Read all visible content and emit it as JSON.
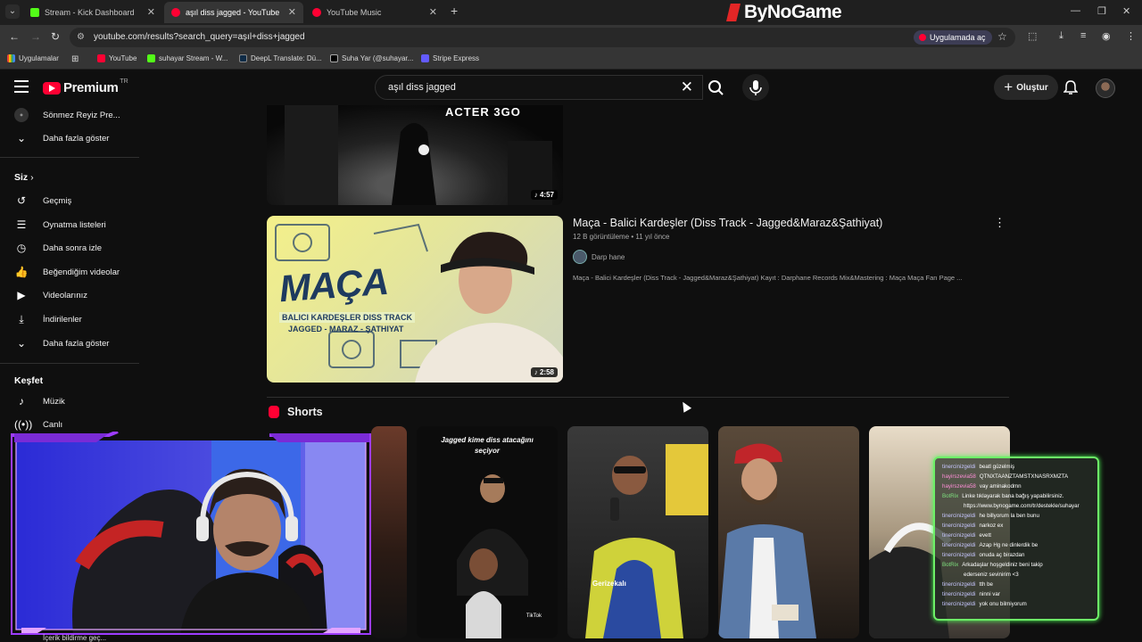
{
  "browser": {
    "tabs": [
      {
        "title": "Stream - Kick Dashboard",
        "color": "#53fc18"
      },
      {
        "title": "aşıl diss jagged - YouTube",
        "color": "#ff0033"
      },
      {
        "title": "YouTube Music",
        "color": "#ff0033"
      }
    ],
    "brand": "ByNoGame",
    "url": "youtube.com/results?search_query=aşıl+diss+jagged",
    "open_in_app": "Uygulamada aç",
    "bookmarks": [
      "Uygulamalar",
      "YouTube",
      "suhayar Stream - W...",
      "DeepL Translate: Dü...",
      "Suha Yar (@suhayar...",
      "Stripe Express"
    ]
  },
  "header": {
    "logo_text": "Premium",
    "logo_region": "TR",
    "search_value": "aşıl diss jagged",
    "create_label": "Oluştur"
  },
  "sidebar": {
    "top_items": [
      {
        "label": "Sönmez Reyiz Pre...",
        "icon": "channel-avatar"
      },
      {
        "label": "Daha fazla göster",
        "icon": "chevron-down-icon"
      }
    ],
    "you_header": "Siz",
    "you_items": [
      {
        "label": "Geçmiş",
        "icon": "history-icon"
      },
      {
        "label": "Oynatma listeleri",
        "icon": "playlist-icon"
      },
      {
        "label": "Daha sonra izle",
        "icon": "clock-icon"
      },
      {
        "label": "Beğendiğim videolar",
        "icon": "thumbs-up-icon"
      },
      {
        "label": "Videolarınız",
        "icon": "video-icon"
      },
      {
        "label": "İndirilenler",
        "icon": "download-icon"
      },
      {
        "label": "Daha fazla göster",
        "icon": "chevron-down-icon"
      }
    ],
    "explore_header": "Keşfet",
    "explore_items": [
      {
        "label": "Müzik",
        "icon": "music-note-icon"
      },
      {
        "label": "Canlı",
        "icon": "live-icon"
      }
    ],
    "bottom_partial": "İçerik bildirme geç..."
  },
  "results": {
    "first_video": {
      "thumb_text": "ACTER 3GO",
      "duration": "4:57"
    },
    "second_video": {
      "title": "Maça - Balici Kardeşler (Diss Track - Jagged&Maraz&Şathiyat)",
      "views": "12 B görüntüleme",
      "age": "11 yıl önce",
      "channel": "Darp hane",
      "description": "Maça - Balici Kardeşler (Diss Track - Jagged&Maraz&Şathiyat) Kayıt : Darphane Records Mix&Mastering : Maça Maça Fan Page ...",
      "thumb_title": "MAÇA",
      "thumb_sub1": "BALICI KARDEŞLER DISS TRACK",
      "thumb_sub2": "JAGGED - MARAZ - ŞATHIYAT",
      "duration": "2:58"
    }
  },
  "shorts": {
    "header": "Shorts",
    "items": [
      {
        "caption": ""
      },
      {
        "caption": "Jagged kime diss atacağını seçiyor",
        "badge": "TikTok"
      },
      {
        "caption": "Gerizekalı"
      },
      {
        "caption": ""
      },
      {
        "caption": ""
      }
    ]
  },
  "chat": [
    {
      "user": "tinercinizgeldi",
      "msg": "beatl güzelmiş",
      "kind": "u"
    },
    {
      "user": "hayirszevia58",
      "msg": "QTNXTAANZTAMSTXNASRXMZTA",
      "kind": "p"
    },
    {
      "user": "hayirszevia58",
      "msg": "vay aminakodmn",
      "kind": "p"
    },
    {
      "user": "BotRix",
      "msg": "Linke tıklayarak bana bağış yapabilirsiniz.",
      "kind": "b"
    },
    {
      "user": "",
      "msg": "https://www.bynogame.com/tr/destekle/suhayar",
      "kind": "u"
    },
    {
      "user": "tinercinizgeldi",
      "msg": "he billyorum la ben bunu",
      "kind": "u"
    },
    {
      "user": "tinercinizgeldi",
      "msg": "narkoz ex",
      "kind": "u"
    },
    {
      "user": "tinercinizgeldi",
      "msg": "evett",
      "kind": "u"
    },
    {
      "user": "tinercinizgeldi",
      "msg": "Azap Hg ne dinlerdik be",
      "kind": "u"
    },
    {
      "user": "tinercinizgeldi",
      "msg": "onuda aç birazdan",
      "kind": "u"
    },
    {
      "user": "BotRix",
      "msg": "Arkadaşlar hoşgeldiniz beni takip",
      "kind": "b"
    },
    {
      "user": "",
      "msg": "ederseniz sevinirim <3",
      "kind": "u"
    },
    {
      "user": "tinercinizgeldi",
      "msg": "tth be",
      "kind": "u"
    },
    {
      "user": "tinercinizgeldi",
      "msg": "ninni var",
      "kind": "u"
    },
    {
      "user": "tinercinizgeldi",
      "msg": "yok onu bilmiyorum",
      "kind": "u"
    }
  ]
}
